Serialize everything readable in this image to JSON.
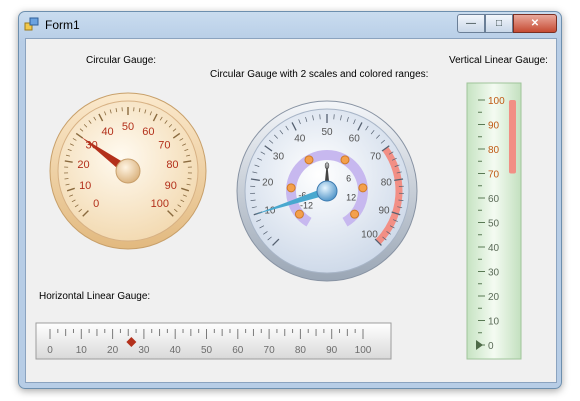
{
  "window": {
    "title": "Form1"
  },
  "labels": {
    "circular": "Circular Gauge:",
    "circular_two": "Circular Gauge with 2 scales and colored ranges:",
    "vertical": "Vertical Linear Gauge:",
    "horizontal": "Horizontal Linear Gauge:"
  },
  "gauge1": {
    "labels": [
      "0",
      "10",
      "20",
      "30",
      "40",
      "50",
      "60",
      "70",
      "80",
      "90",
      "100"
    ],
    "value": 30
  },
  "gauge2": {
    "outer_labels": [
      "10",
      "20",
      "30",
      "40",
      "50",
      "60",
      "70",
      "80",
      "90",
      "100"
    ],
    "inner_labels": [
      "-6",
      "-12",
      "0",
      "6",
      "12"
    ],
    "outer_value": 10,
    "inner_value": 0,
    "range_from": 70,
    "range_to": 100
  },
  "vertical": {
    "labels": [
      "100",
      "90",
      "80",
      "70",
      "60",
      "50",
      "40",
      "30",
      "20",
      "10",
      "0"
    ],
    "range_from": 70,
    "range_to": 100
  },
  "horizontal": {
    "labels": [
      "0",
      "10",
      "20",
      "30",
      "40",
      "50",
      "60",
      "70",
      "80",
      "90",
      "100"
    ],
    "value": 26
  },
  "colors": {
    "accent_red": "#b3301b",
    "range_red": "#f28f85",
    "blue_needle": "#49a8cf",
    "orange_dot": "#f4a04c"
  }
}
